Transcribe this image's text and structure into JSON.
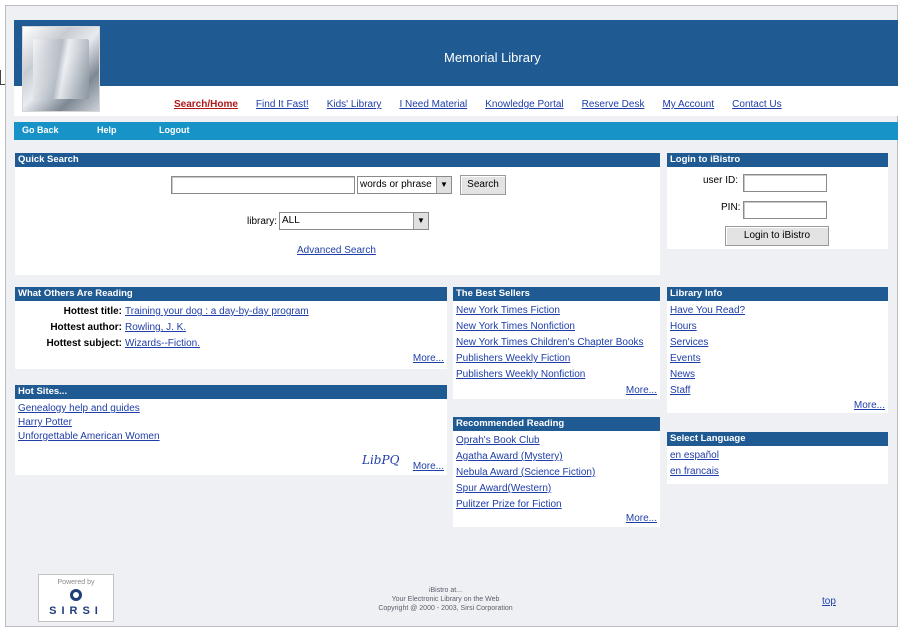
{
  "header": {
    "title": "Memorial Library",
    "nav": [
      "Search/Home",
      "Find It Fast!",
      "Kids' Library",
      "I Need Material",
      "Knowledge Portal",
      "Reserve Desk",
      "My Account",
      "Contact Us"
    ]
  },
  "toolbar": {
    "go_back": "Go Back",
    "help": "Help",
    "logout": "Logout"
  },
  "quick_search": {
    "title": "Quick Search",
    "query_value": "",
    "mode_value": "words or phrase",
    "search_button": "Search",
    "library_label": "library:",
    "library_value": "ALL",
    "advanced_link": "Advanced Search"
  },
  "login": {
    "title": "Login to iBistro",
    "user_label": "user ID:",
    "pin_label": "PIN:",
    "button": "Login to iBistro"
  },
  "others_reading": {
    "title": "What Others Are Reading",
    "hottest_title_label": "Hottest title:",
    "hottest_title": "Training your dog : a day-by-day program",
    "hottest_author_label": "Hottest author:",
    "hottest_author": "Rowling, J. K.",
    "hottest_subject_label": "Hottest subject:",
    "hottest_subject": "Wizards--Fiction.",
    "more": "More..."
  },
  "hot_sites": {
    "title": "Hot Sites...",
    "items": [
      "Genealogy help and guides",
      "Harry Potter",
      "Unforgettable American Women"
    ],
    "logo_text": "LibPQ",
    "more": "More..."
  },
  "best_sellers": {
    "title": "The Best Sellers",
    "items": [
      "New York Times Fiction",
      "New York Times Nonfiction",
      "New York Times Children's Chapter Books",
      "Publishers Weekly Fiction",
      "Publishers Weekly Nonfiction"
    ],
    "more": "More..."
  },
  "recommended": {
    "title": "Recommended Reading",
    "items": [
      "Oprah's Book Club",
      "Agatha Award (Mystery)",
      "Nebula Award (Science Fiction)",
      "Spur Award(Western)",
      "Pulitzer Prize for Fiction"
    ],
    "more": "More..."
  },
  "library_info": {
    "title": "Library Info",
    "items": [
      "Have You Read?",
      "Hours",
      "Services",
      "Events",
      "News",
      "Staff"
    ],
    "more": "More..."
  },
  "language": {
    "title": "Select Language",
    "items": [
      "en español",
      "en francais"
    ]
  },
  "footer": {
    "powered_by": "Powered by",
    "sirsi": "SIRSI",
    "line1": "iBistro at...",
    "line2": "Your Electronic Library on the Web",
    "line3": "Copyright @ 2000 - 2003, Sirsi Corporation",
    "top": "top"
  }
}
